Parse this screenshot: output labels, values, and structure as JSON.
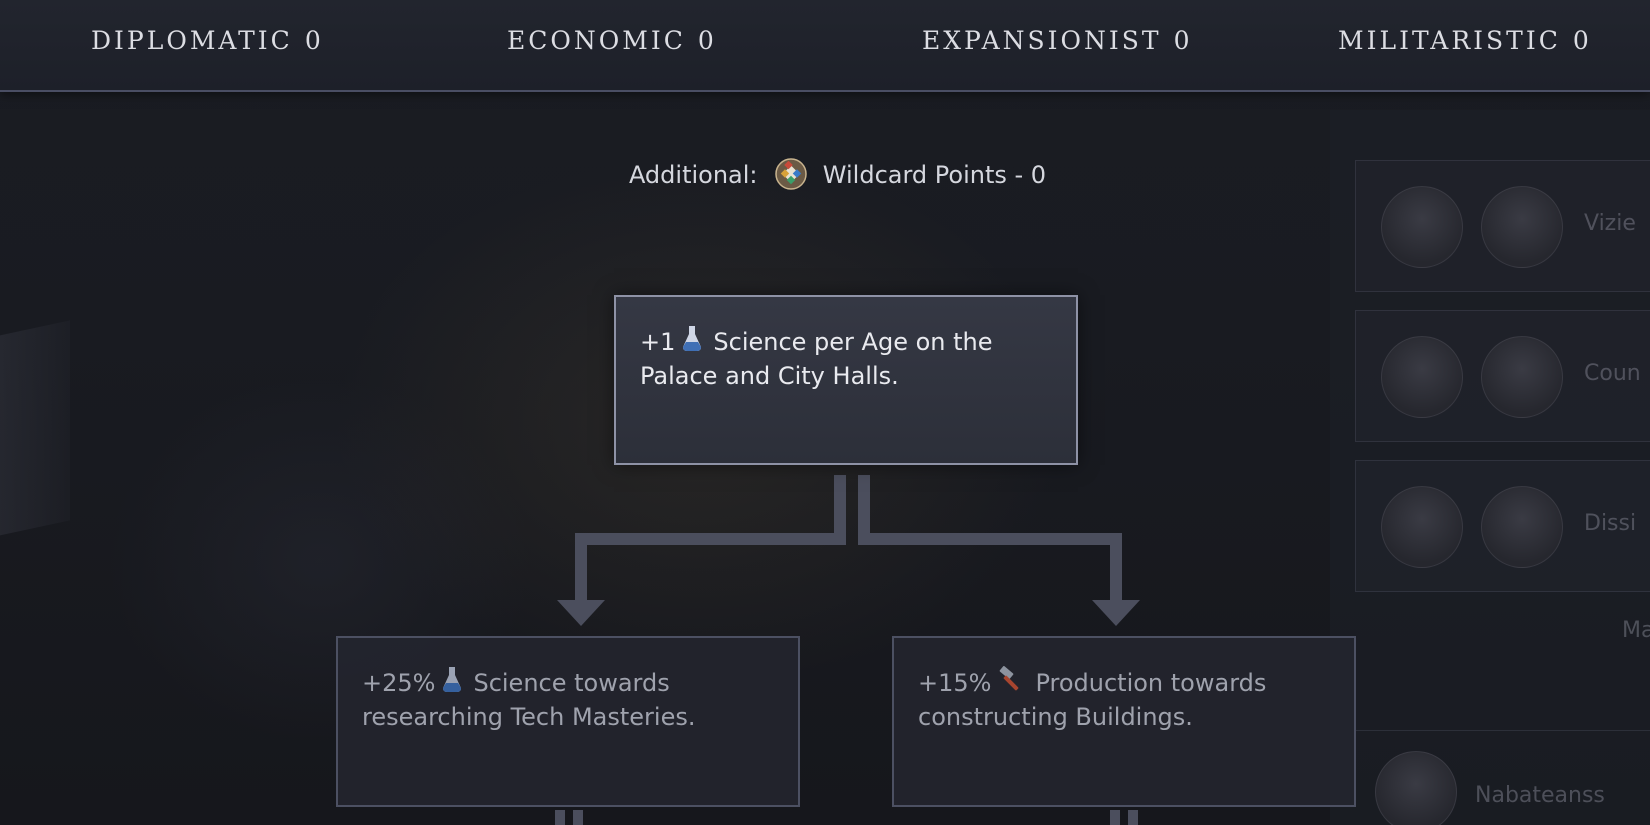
{
  "topbar": {
    "tabs": [
      {
        "label": "DIPLOMATIC",
        "value": "0"
      },
      {
        "label": "ECONOMIC",
        "value": "0"
      },
      {
        "label": "EXPANSIONIST",
        "value": "0"
      },
      {
        "label": "MILITARISTIC",
        "value": "0"
      }
    ]
  },
  "additional": {
    "prefix": "Additional:",
    "icon": "wildcard-icon",
    "text": "Wildcard Points - 0"
  },
  "tree": {
    "root": {
      "amount": "+1",
      "icon": "science-flask-icon",
      "text": "Science per Age on the Palace and City Halls."
    },
    "left": {
      "amount": "+25%",
      "icon": "science-flask-icon",
      "text": "Science towards researching Tech Masteries."
    },
    "right": {
      "amount": "+15%",
      "icon": "production-hammer-icon",
      "text": "Production towards constructing Buildings."
    }
  },
  "side": {
    "rows": [
      {
        "label": "Vizie"
      },
      {
        "label": "Coun"
      },
      {
        "label": "Dissi"
      },
      {
        "label": "Ma"
      }
    ],
    "footer_label": "Nabateanss"
  },
  "colors": {
    "accent_border": "#8e92a6",
    "tab_text": "#dcdde3",
    "science": "#3f6fb5",
    "production": "#a8452f"
  }
}
